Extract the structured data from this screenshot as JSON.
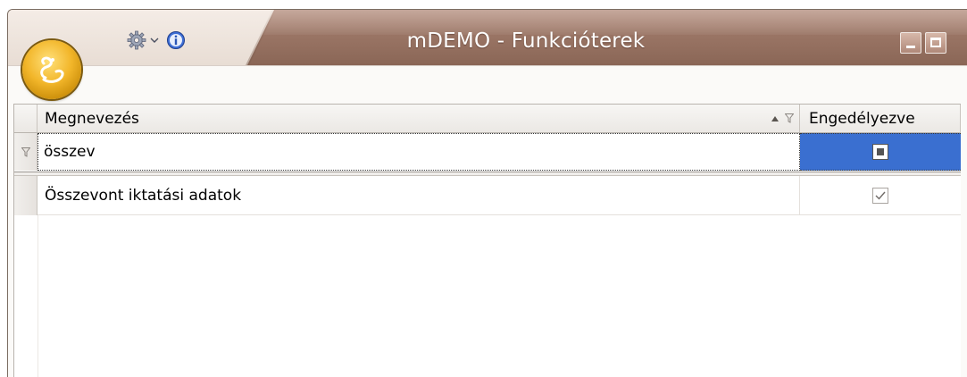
{
  "window": {
    "title": "mDEMO - Funkcióterek"
  },
  "qat": {
    "settings_icon": "gear-icon",
    "dropdown_icon": "chevron-down-icon",
    "info_icon": "info-icon"
  },
  "grid": {
    "columns": [
      {
        "label": "Megnevezés",
        "sort": "ascending",
        "filter_icon": "filter-icon"
      },
      {
        "label": "Engedélyezve"
      }
    ],
    "filter_row": {
      "indicator_icon": "filter-icon",
      "text": "összev",
      "checkbox_state": "indeterminate"
    },
    "rows": [
      {
        "name": "Összevont iktatási adatok",
        "enabled": true
      }
    ]
  },
  "colors": {
    "titlebar": "#9a7565",
    "selection": "#3a6fd0",
    "orb": "#f2b62a"
  }
}
